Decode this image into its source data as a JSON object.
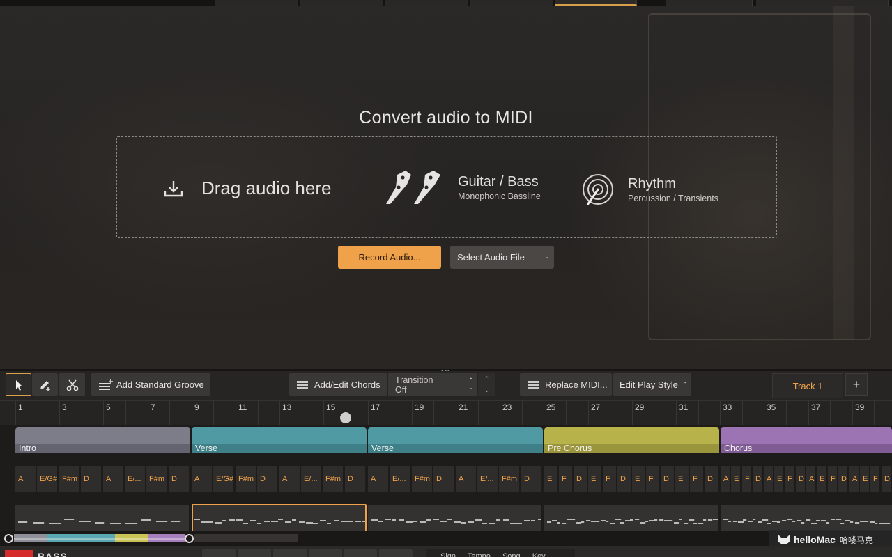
{
  "convert": {
    "title": "Convert audio to MIDI",
    "drag_label": "Drag audio here",
    "guitar_title": "Guitar / Bass",
    "guitar_sub": "Monophonic Bassline",
    "rhythm_title": "Rhythm",
    "rhythm_sub": "Percussion / Transients",
    "record_button": "Record Audio...",
    "select_button": "Select Audio File"
  },
  "toolbar": {
    "add_groove": "Add Standard Groove",
    "add_chords": "Add/Edit Chords",
    "transition_label": "Transition",
    "transition_value": "Off",
    "replace_midi": "Replace MIDI...",
    "edit_play_style": "Edit Play Style",
    "track_tab": "Track 1",
    "add_track": "+"
  },
  "ruler": [
    "1",
    "3",
    "5",
    "7",
    "9",
    "11",
    "13",
    "15",
    "17",
    "19",
    "21",
    "23",
    "25",
    "27",
    "29",
    "31",
    "33",
    "35",
    "37",
    "39"
  ],
  "sections": [
    {
      "label": "Intro",
      "color": "#7c7d88",
      "bar": "#636470"
    },
    {
      "label": "Verse",
      "color": "#4f9aa3",
      "bar": "#3f7f87"
    },
    {
      "label": "Verse",
      "color": "#4f9aa3",
      "bar": "#3f7f87"
    },
    {
      "label": "Pre Chorus",
      "color": "#b8b24a",
      "bar": "#9a953c"
    },
    {
      "label": "Chorus",
      "color": "#9c73b3",
      "bar": "#7f5c93"
    }
  ],
  "chords": [
    [
      "A",
      "E/G#",
      "F#m",
      "D",
      "A",
      "E/...",
      "F#m",
      "D"
    ],
    [
      "A",
      "E/G#",
      "F#m",
      "D",
      "A",
      "E/...",
      "F#m",
      "D"
    ],
    [
      "A",
      "E/...",
      "F#m",
      "D",
      "A",
      "E/...",
      "F#m",
      "D"
    ],
    [
      "E",
      "F",
      "D",
      "E",
      "F",
      "D",
      "E",
      "F",
      "D",
      "E",
      "F",
      "D"
    ],
    [
      "A",
      "E",
      "F",
      "D",
      "A",
      "E",
      "F",
      "D",
      "A",
      "E",
      "F",
      "D",
      "A",
      "E",
      "F",
      "D"
    ]
  ],
  "bottom": {
    "name": "BASS",
    "info": "Sign Tempo Song Key"
  },
  "watermark": {
    "brand": "helloMac",
    "cn": "哈喽马克"
  },
  "colors": {
    "accent": "#f0a24b",
    "intro": "#7c7d88",
    "verse": "#4f9aa3",
    "prechorus": "#b8b24a",
    "chorus": "#9c73b3"
  }
}
